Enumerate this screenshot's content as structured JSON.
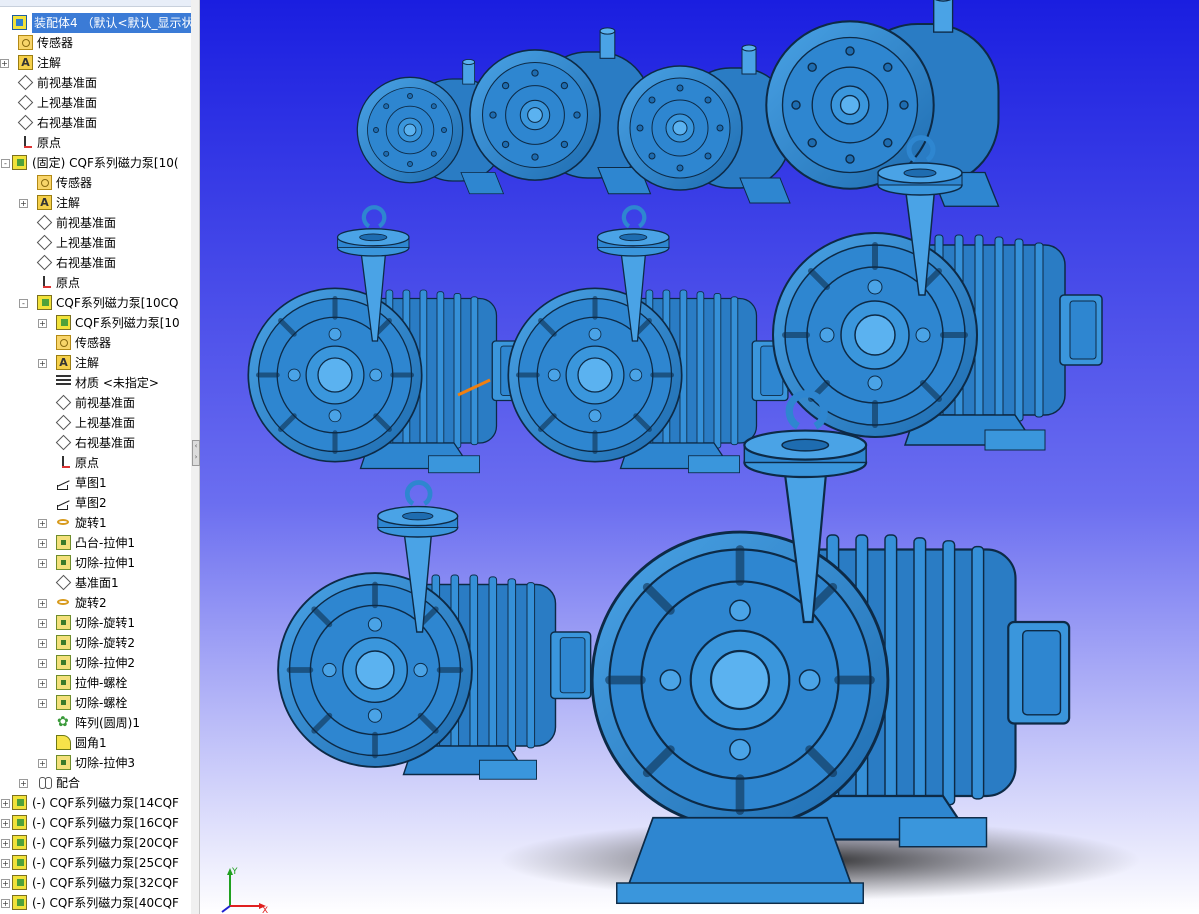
{
  "tree": {
    "items": [
      {
        "label": "装配体4 （默认<默认_显示状态",
        "indent": 0,
        "icon": "assembly-icon",
        "expander": "",
        "root": true
      },
      {
        "label": "传感器",
        "indent": 1,
        "icon": "sensor-icon",
        "expander": ""
      },
      {
        "label": "注解",
        "indent": 1,
        "icon": "annotation-icon",
        "expander": "+"
      },
      {
        "label": "前视基准面",
        "indent": 1,
        "icon": "plane-icon",
        "expander": ""
      },
      {
        "label": "上视基准面",
        "indent": 1,
        "icon": "plane-icon",
        "expander": ""
      },
      {
        "label": "右视基准面",
        "indent": 1,
        "icon": "plane-icon",
        "expander": ""
      },
      {
        "label": "原点",
        "indent": 1,
        "icon": "origin-icon",
        "expander": ""
      },
      {
        "label": "(固定) CQF系列磁力泵[10(",
        "indent": 0,
        "icon": "part-icon",
        "expander": "-"
      },
      {
        "label": "传感器",
        "indent": 2,
        "icon": "sensor-icon",
        "expander": ""
      },
      {
        "label": "注解",
        "indent": 2,
        "icon": "annotation-icon",
        "expander": "+"
      },
      {
        "label": "前视基准面",
        "indent": 2,
        "icon": "plane-icon",
        "expander": ""
      },
      {
        "label": "上视基准面",
        "indent": 2,
        "icon": "plane-icon",
        "expander": ""
      },
      {
        "label": "右视基准面",
        "indent": 2,
        "icon": "plane-icon",
        "expander": ""
      },
      {
        "label": "原点",
        "indent": 2,
        "icon": "origin-icon",
        "expander": ""
      },
      {
        "label": "CQF系列磁力泵[10CQ",
        "indent": 2,
        "icon": "part-icon",
        "expander": "-"
      },
      {
        "label": "CQF系列磁力泵[10",
        "indent": 3,
        "icon": "part-feature-icon",
        "expander": "+"
      },
      {
        "label": "传感器",
        "indent": 3,
        "icon": "sensor-icon",
        "expander": ""
      },
      {
        "label": "注解",
        "indent": 3,
        "icon": "annotation-icon",
        "expander": "+"
      },
      {
        "label": "材质 <未指定>",
        "indent": 3,
        "icon": "material-icon",
        "expander": ""
      },
      {
        "label": "前视基准面",
        "indent": 3,
        "icon": "plane-icon",
        "expander": ""
      },
      {
        "label": "上视基准面",
        "indent": 3,
        "icon": "plane-icon",
        "expander": ""
      },
      {
        "label": "右视基准面",
        "indent": 3,
        "icon": "plane-icon",
        "expander": ""
      },
      {
        "label": "原点",
        "indent": 3,
        "icon": "origin-icon",
        "expander": ""
      },
      {
        "label": "草图1",
        "indent": 3,
        "icon": "sketch-icon",
        "expander": ""
      },
      {
        "label": "草图2",
        "indent": 3,
        "icon": "sketch-icon",
        "expander": ""
      },
      {
        "label": "旋转1",
        "indent": 3,
        "icon": "revolve-icon",
        "expander": "+"
      },
      {
        "label": "凸台-拉伸1",
        "indent": 3,
        "icon": "extrude-icon",
        "expander": "+"
      },
      {
        "label": "切除-拉伸1",
        "indent": 3,
        "icon": "cut-extrude-icon",
        "expander": "+"
      },
      {
        "label": "基准面1",
        "indent": 3,
        "icon": "plane-icon",
        "expander": ""
      },
      {
        "label": "旋转2",
        "indent": 3,
        "icon": "revolve-icon",
        "expander": "+"
      },
      {
        "label": "切除-旋转1",
        "indent": 3,
        "icon": "cut-revolve-icon",
        "expander": "+"
      },
      {
        "label": "切除-旋转2",
        "indent": 3,
        "icon": "cut-revolve-icon",
        "expander": "+"
      },
      {
        "label": "切除-拉伸2",
        "indent": 3,
        "icon": "cut-extrude-icon",
        "expander": "+"
      },
      {
        "label": "拉伸-螺栓",
        "indent": 3,
        "icon": "extrude-icon",
        "expander": "+"
      },
      {
        "label": "切除-螺栓",
        "indent": 3,
        "icon": "cut-extrude-icon",
        "expander": "+"
      },
      {
        "label": "阵列(圆周)1",
        "indent": 3,
        "icon": "pattern-icon",
        "expander": ""
      },
      {
        "label": "圆角1",
        "indent": 3,
        "icon": "fillet-icon",
        "expander": ""
      },
      {
        "label": "切除-拉伸3",
        "indent": 3,
        "icon": "cut-extrude-icon",
        "expander": "+"
      },
      {
        "label": "配合",
        "indent": 2,
        "icon": "mate-icon",
        "expander": "+"
      },
      {
        "label": "(-) CQF系列磁力泵[14CQF",
        "indent": 0,
        "icon": "part-icon",
        "expander": "+"
      },
      {
        "label": "(-) CQF系列磁力泵[16CQF",
        "indent": 0,
        "icon": "part-icon",
        "expander": "+"
      },
      {
        "label": "(-) CQF系列磁力泵[20CQF",
        "indent": 0,
        "icon": "part-icon",
        "expander": "+"
      },
      {
        "label": "(-) CQF系列磁力泵[25CQF",
        "indent": 0,
        "icon": "part-icon",
        "expander": "+"
      },
      {
        "label": "(-) CQF系列磁力泵[32CQF",
        "indent": 0,
        "icon": "part-icon",
        "expander": "+"
      },
      {
        "label": "(-) CQF系列磁力泵[40CQF",
        "indent": 0,
        "icon": "part-icon",
        "expander": "+"
      }
    ]
  },
  "viewport": {
    "background_top": "#1a1ee0",
    "background_bottom": "#ffffff",
    "pump_color": "#2e86d0",
    "pump_dark": "#1a5a94",
    "pump_light": "#4aa3e6",
    "highlight_color": "#f07f10",
    "triad": {
      "x_label": "X",
      "y_label": "Y",
      "x_color": "#e02020",
      "y_color": "#20a020",
      "z_color": "#2020d0"
    }
  }
}
